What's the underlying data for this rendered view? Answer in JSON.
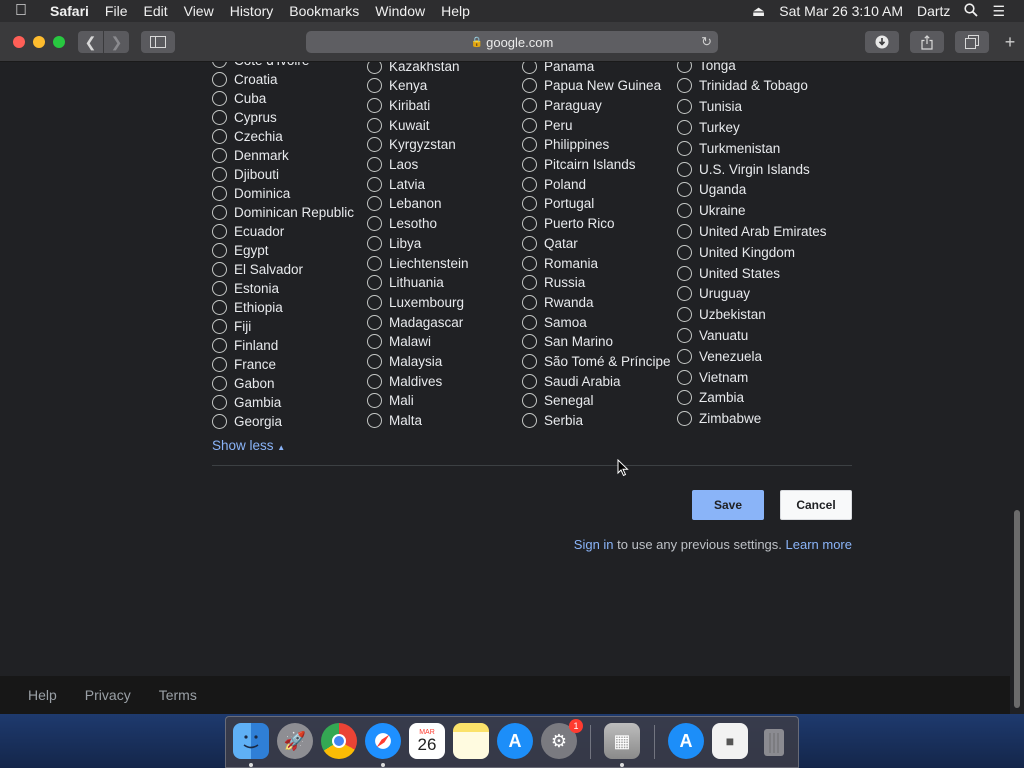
{
  "menubar": {
    "apple": "",
    "items": [
      "Safari",
      "File",
      "Edit",
      "View",
      "History",
      "Bookmarks",
      "Window",
      "Help"
    ],
    "datetime": "Sat Mar 26  3:10 AM",
    "user": "Dartz"
  },
  "browser": {
    "url": "google.com"
  },
  "countries": {
    "col1": [
      "Côte d'Ivoire",
      "Croatia",
      "Cuba",
      "Cyprus",
      "Czechia",
      "Denmark",
      "Djibouti",
      "Dominica",
      "Dominican Republic",
      "Ecuador",
      "Egypt",
      "El Salvador",
      "Estonia",
      "Ethiopia",
      "Fiji",
      "Finland",
      "France",
      "Gabon",
      "Gambia",
      "Georgia"
    ],
    "col2": [
      "Kazakhstan",
      "Kenya",
      "Kiribati",
      "Kuwait",
      "Kyrgyzstan",
      "Laos",
      "Latvia",
      "Lebanon",
      "Lesotho",
      "Libya",
      "Liechtenstein",
      "Lithuania",
      "Luxembourg",
      "Madagascar",
      "Malawi",
      "Malaysia",
      "Maldives",
      "Mali",
      "Malta"
    ],
    "col3": [
      "Panama",
      "Papua New Guinea",
      "Paraguay",
      "Peru",
      "Philippines",
      "Pitcairn Islands",
      "Poland",
      "Portugal",
      "Puerto Rico",
      "Qatar",
      "Romania",
      "Russia",
      "Rwanda",
      "Samoa",
      "San Marino",
      "São Tomé & Príncipe",
      "Saudi Arabia",
      "Senegal",
      "Serbia"
    ],
    "col4": [
      "Tonga",
      "Trinidad & Tobago",
      "Tunisia",
      "Turkey",
      "Turkmenistan",
      "U.S. Virgin Islands",
      "Uganda",
      "Ukraine",
      "United Arab Emirates",
      "United Kingdom",
      "United States",
      "Uruguay",
      "Uzbekistan",
      "Vanuatu",
      "Venezuela",
      "Vietnam",
      "Zambia",
      "Zimbabwe"
    ]
  },
  "actions": {
    "show_less": "Show less",
    "save": "Save",
    "cancel": "Cancel"
  },
  "signin": {
    "link": "Sign in",
    "text": " to use any previous settings. ",
    "learn_more": "Learn more"
  },
  "footer": {
    "help": "Help",
    "privacy": "Privacy",
    "terms": "Terms"
  },
  "dock": {
    "calendar_month": "MAR",
    "calendar_day": "26",
    "system_prefs_badge": "1",
    "apps": [
      "finder",
      "launchpad",
      "chrome",
      "safari",
      "calendar",
      "notes",
      "app-store",
      "system-preferences",
      "archive-utility",
      "app-store-downloads",
      "document",
      "trash"
    ]
  }
}
